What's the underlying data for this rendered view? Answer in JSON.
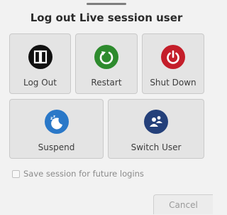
{
  "dialog": {
    "title": "Log out Live session user"
  },
  "actions": [
    {
      "label": "Log Out",
      "icon": "logout-icon",
      "color": "#111111"
    },
    {
      "label": "Restart",
      "icon": "restart-icon",
      "color": "#2e8b2e"
    },
    {
      "label": "Shut Down",
      "icon": "power-icon",
      "color": "#c41e2a"
    },
    {
      "label": "Suspend",
      "icon": "moon-icon",
      "color": "#2a78c8"
    },
    {
      "label": "Switch User",
      "icon": "switch-user-icon",
      "color": "#24407a"
    }
  ],
  "save_session": {
    "label": "Save session for future logins",
    "checked": false
  },
  "footer": {
    "cancel_label": "Cancel"
  }
}
